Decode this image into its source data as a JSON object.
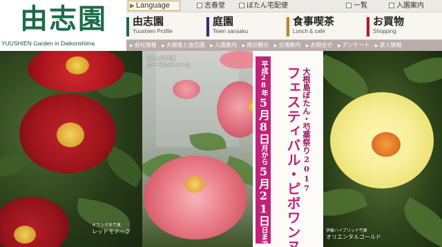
{
  "header": {
    "logo_text": "由志園",
    "logo_sub": "YUUSHIEN Garden in Daikonshima"
  },
  "topbar": {
    "language_label": "Language",
    "links": [
      "志春堂",
      "ぼたん宅配便",
      "一覧",
      "入園案内"
    ]
  },
  "nav": {
    "items": [
      {
        "ja": "由志園",
        "en": "Yuushien Profile",
        "color": "#1d6b4a"
      },
      {
        "ja": "庭園",
        "en": "Teien sansaku",
        "color": "#3a2a7e"
      },
      {
        "ja": "食事喫茶",
        "en": "Lunch & cafe",
        "color": "#c0861c"
      },
      {
        "ja": "お買物",
        "en": "Shopping",
        "color": "#b5192a"
      }
    ]
  },
  "subnav": {
    "items": [
      "会社情報",
      "大根島と由志園",
      "入園案内",
      "周辺観光",
      "交通案内",
      "お問合せ",
      "アンケート",
      "求人情報"
    ]
  },
  "hero": {
    "captions": {
      "left": {
        "small": "オランダ系芍薬",
        "big": "レッドモナーク"
      },
      "middle": {
        "small": "オランダ系芍薬",
        "big": "コーラルチャーム"
      },
      "right": {
        "small": "伊藤ハイブリッド芍薬",
        "big": "オリエンタルゴールド"
      }
    },
    "banner": {
      "title": "フェスティバル・ピボワンヌ",
      "subtitle": "大根島ぼたん・芍薬祭り2017",
      "year": "平成28年",
      "start": "5月8日",
      "start_day": "月",
      "connector": "から",
      "end": "5月21日",
      "end_day": "日",
      "suffix": "まで"
    },
    "colors": {
      "banner_accent": "#c0237a",
      "red_flower": "#9c1219",
      "pink_flower": "#e07583",
      "yellow_flower": "#f3ec8e"
    }
  }
}
